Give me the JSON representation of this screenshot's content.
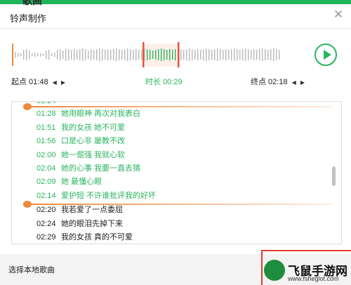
{
  "header": {
    "partial_text": "歌曲"
  },
  "dialog": {
    "title": "铃声制作",
    "close_icon": "close-icon"
  },
  "waveform": {
    "play_icon": "play-icon",
    "accent": "#2bb45f",
    "selection_color": "#e8533a"
  },
  "controls": {
    "start_label": "起点 01:48",
    "duration_label": "时长 00:29",
    "end_label": "终点 02:18"
  },
  "lyrics": {
    "rows": [
      {
        "time": "01:28",
        "text": "她用眼神 再次对我表白",
        "selected": true
      },
      {
        "time": "01:51",
        "text": "我的女孩 她不可爱",
        "selected": true
      },
      {
        "time": "01:56",
        "text": "口是心非 屡教不改",
        "selected": true
      },
      {
        "time": "02:00",
        "text": "她一倔强 我就心软",
        "selected": true
      },
      {
        "time": "02:04",
        "text": "她的心事 我要一直去猜",
        "selected": true
      },
      {
        "time": "02:09",
        "text": "她 最懂心眼",
        "selected": true
      },
      {
        "time": "02:14",
        "text": "爱护短 不许谁批评我的好坏",
        "selected": true
      },
      {
        "time": "02:20",
        "text": "我若爱了一点委屈",
        "selected": false
      },
      {
        "time": "02:24",
        "text": "她的眼泪先掉下来",
        "selected": false
      },
      {
        "time": "02:29",
        "text": "我的女孩 真的不可爱",
        "selected": false
      }
    ]
  },
  "footer": {
    "label": "选择本地歌曲"
  },
  "watermark": {
    "text": "飞鼠手游网",
    "url": "www.fsheglot.com"
  }
}
